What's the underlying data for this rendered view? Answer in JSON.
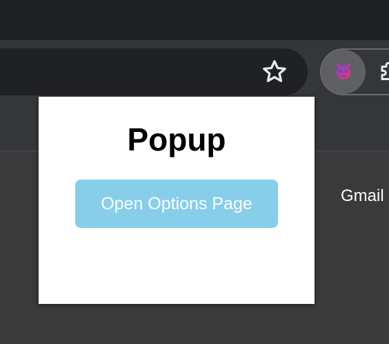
{
  "colors": {
    "titlebar": "#202124",
    "toolbar": "#35363a",
    "content": "#3a3a3a",
    "omnibox": "#202124",
    "popup_background": "#ffffff",
    "button_background": "#87ceeb",
    "button_text": "#ffffff",
    "extension_icon": "#c837d6"
  },
  "toolbar": {
    "bookmark_icon": "star-icon",
    "extension_icon": "extension-icon",
    "extensions_menu_icon": "puzzle-icon"
  },
  "page": {
    "gmail_link": "Gmail"
  },
  "popup": {
    "title": "Popup",
    "button_label": "Open Options Page"
  }
}
